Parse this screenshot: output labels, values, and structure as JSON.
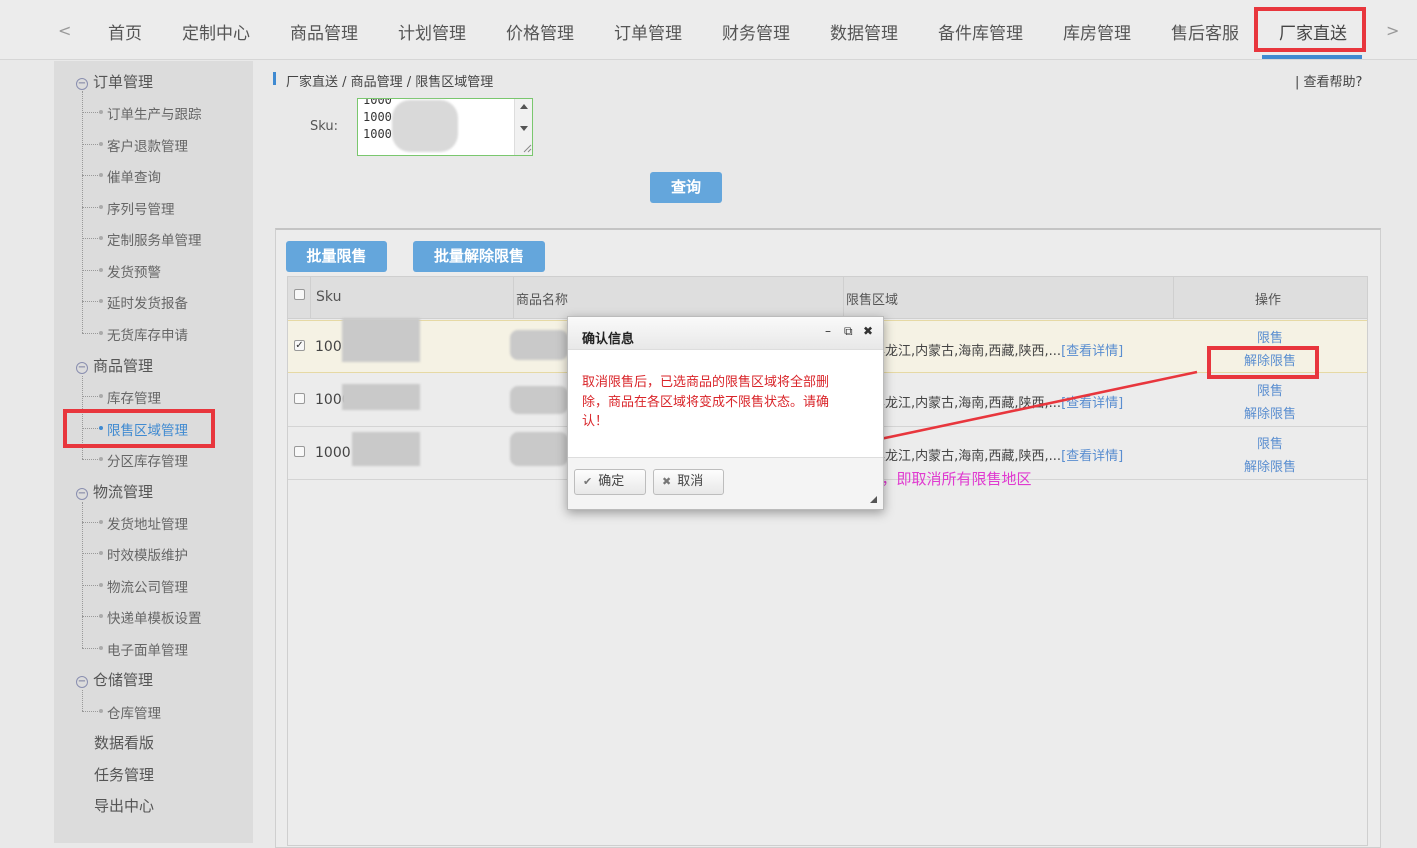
{
  "topnav": {
    "prev": "<",
    "next": ">",
    "items": [
      "首页",
      "定制中心",
      "商品管理",
      "计划管理",
      "价格管理",
      "订单管理",
      "财务管理",
      "数据管理",
      "备件库管理",
      "库房管理",
      "售后客服",
      "厂家直送"
    ],
    "active_index": 11
  },
  "sidebar": {
    "groups": [
      {
        "icon": "minus-circle-icon",
        "label": "订单管理",
        "items": [
          "订单生产与跟踪",
          "客户退款管理",
          "催单查询",
          "序列号管理",
          "定制服务单管理",
          "发货预警",
          "延时发货报备",
          "无货库存申请"
        ]
      },
      {
        "icon": "minus-circle-icon",
        "label": "商品管理",
        "items": [
          "库存管理",
          "限售区域管理",
          "分区库存管理"
        ]
      },
      {
        "icon": "minus-circle-icon",
        "label": "物流管理",
        "items": [
          "发货地址管理",
          "时效模版维护",
          "物流公司管理",
          "快递单模板设置",
          "电子面单管理"
        ]
      },
      {
        "icon": "minus-circle-icon",
        "label": "仓储管理",
        "items": [
          "仓库管理"
        ]
      }
    ],
    "plain_items": [
      "数据看版",
      "任务管理",
      "导出中心"
    ],
    "selected": "限售区域管理"
  },
  "breadcrumb": "厂家直送 / 商品管理 / 限售区域管理",
  "help": "| 查看帮助?",
  "search": {
    "sku_label": "Sku:",
    "sku_lines": [
      "1000",
      "1000",
      "1000"
    ],
    "query_button": "查询"
  },
  "toolbar": {
    "batch_restrict": "批量限售",
    "batch_unrestrict": "批量解除限售"
  },
  "table": {
    "headers": {
      "sku": "Sku",
      "name": "商品名称",
      "region": "限售区域",
      "action": "操作"
    },
    "rows": [
      {
        "checked": true,
        "sku": "100",
        "region": "黑龙江,内蒙古,海南,西藏,陕西,...",
        "detail": "[查看详情]",
        "action1": "限售",
        "action2": "解除限售"
      },
      {
        "checked": false,
        "sku": "1000",
        "region": "黑龙江,内蒙古,海南,西藏,陕西,...",
        "detail": "[查看详情]",
        "action1": "限售",
        "action2": "解除限售"
      },
      {
        "checked": false,
        "sku": "1000",
        "region": "黑龙江,内蒙古,海南,西藏,陕西,...",
        "detail": "[查看详情]",
        "action1": "限售",
        "action2": "解除限售"
      }
    ]
  },
  "dialog": {
    "title": "确认信息",
    "controls": {
      "minimize": "–",
      "popout": "⧉",
      "close": "✖"
    },
    "message": "取消限售后，已选商品的限售区域将全部删除，商品在各区域将变成不限售状态。请确认！",
    "ok": "确定",
    "cancel": "取消"
  },
  "annotation": "点击“解除限售”，即取消所有限售地区",
  "colors": {
    "accent": "#3f8ad1",
    "button": "#64a6dc",
    "highlight": "#e8363d",
    "annotation": "#e03ad0",
    "warning": "#d9252a"
  }
}
